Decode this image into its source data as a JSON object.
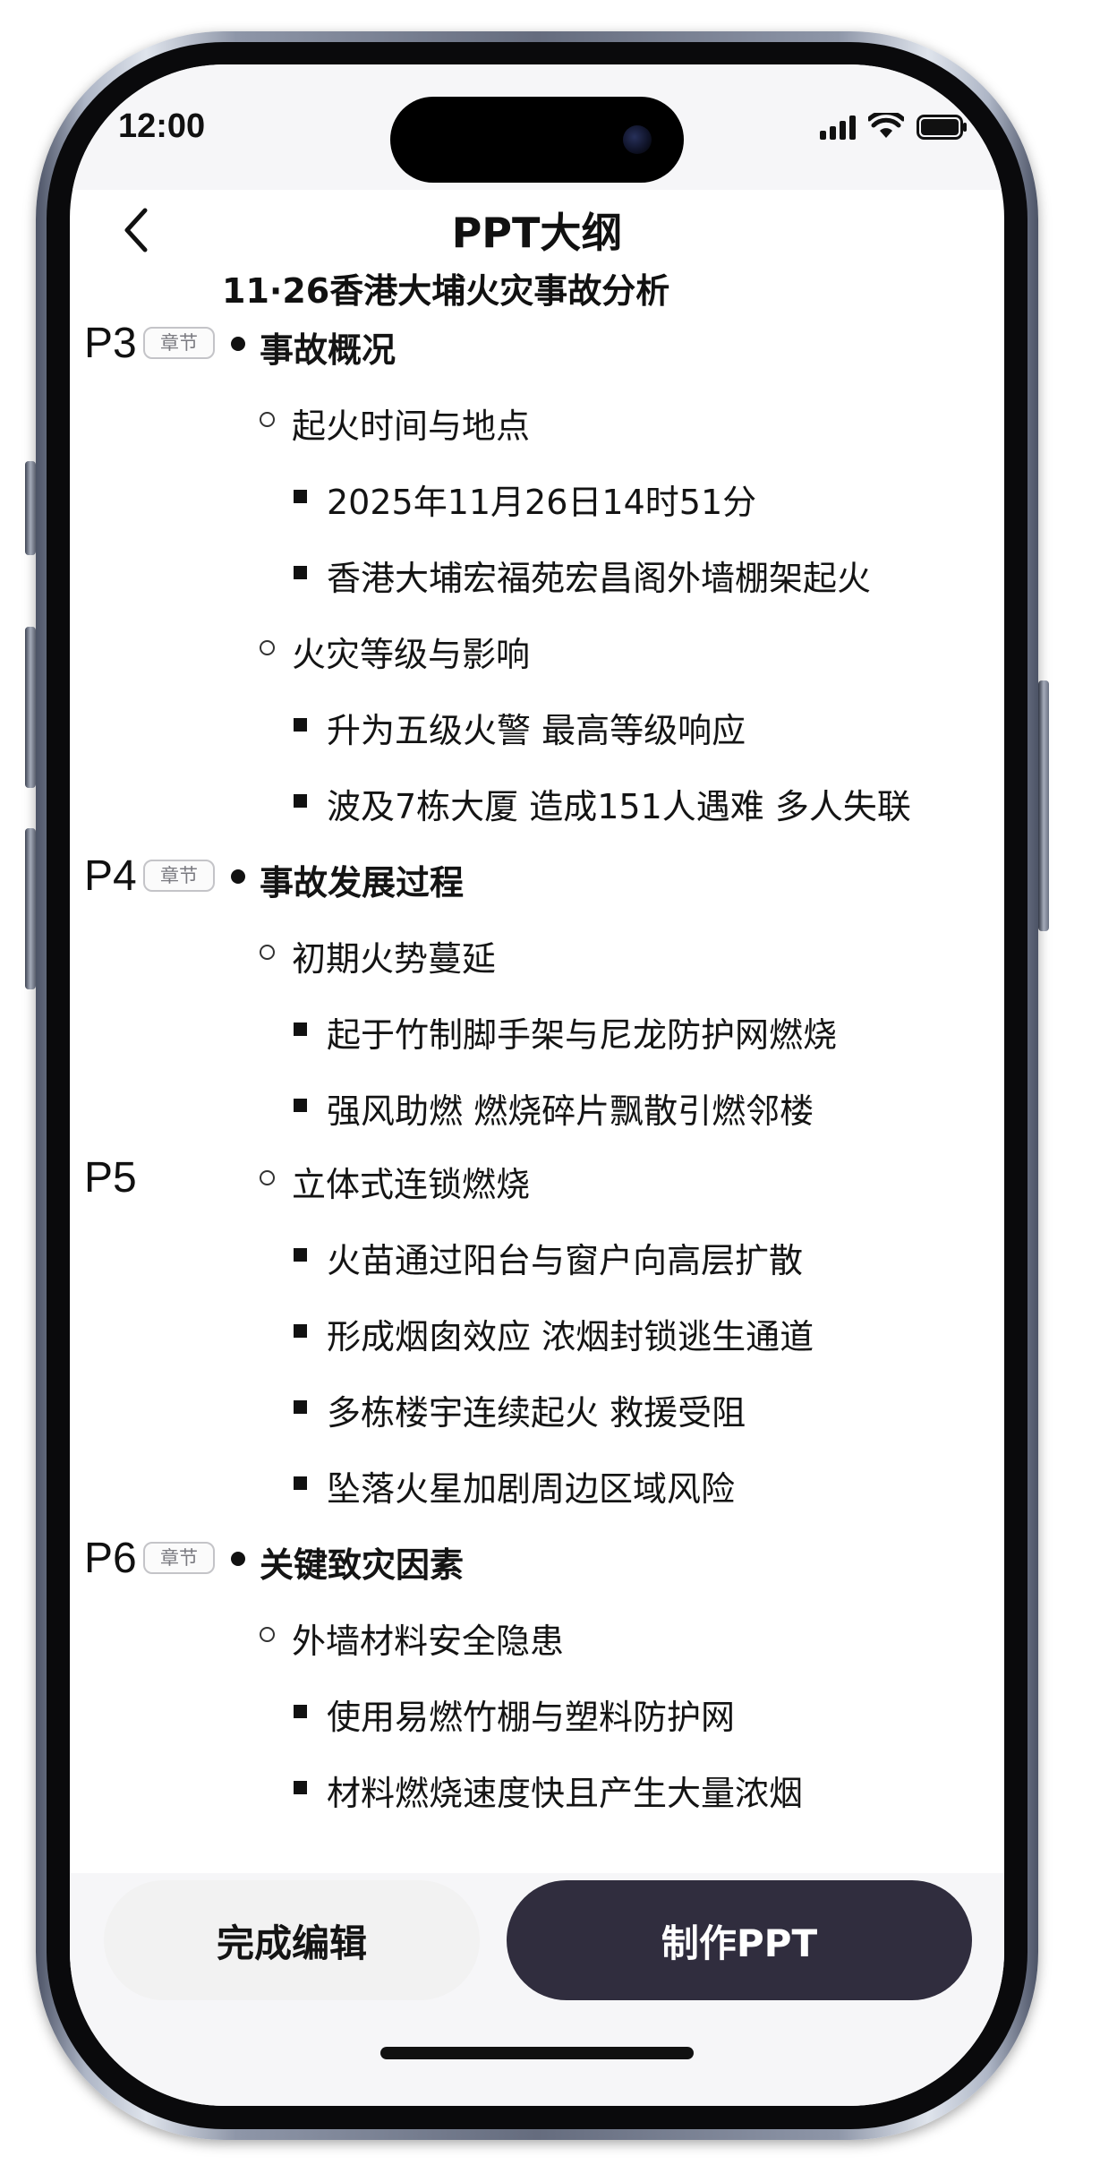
{
  "status_bar": {
    "time": "12:00",
    "icons": [
      "cellular-signal-icon",
      "wifi-icon",
      "battery-icon"
    ]
  },
  "header": {
    "back_icon": "chevron-left-icon",
    "title": "PPT大纲"
  },
  "outline": {
    "title": "11·26香港大埔火灾事故分析",
    "chapter_tag": "章节",
    "rows": [
      {
        "page": "P3",
        "chapter": true,
        "level": 1,
        "text": "事故概况"
      },
      {
        "level": 2,
        "text": "起火时间与地点"
      },
      {
        "level": 3,
        "text": "2025年11月26日14时51分"
      },
      {
        "level": 3,
        "text": "香港大埔宏福苑宏昌阁外墙棚架起火"
      },
      {
        "level": 2,
        "text": "火灾等级与影响"
      },
      {
        "level": 3,
        "text": "升为五级火警 最高等级响应"
      },
      {
        "level": 3,
        "text": "波及7栋大厦 造成151人遇难 多人失联"
      },
      {
        "page": "P4",
        "chapter": true,
        "level": 1,
        "text": "事故发展过程"
      },
      {
        "level": 2,
        "text": "初期火势蔓延"
      },
      {
        "level": 3,
        "text": "起于竹制脚手架与尼龙防护网燃烧"
      },
      {
        "level": 3,
        "text": "强风助燃 燃烧碎片飘散引燃邻楼"
      },
      {
        "page": "P5",
        "chapter": false,
        "level": 2,
        "text": "立体式连锁燃烧"
      },
      {
        "level": 3,
        "text": "火苗通过阳台与窗户向高层扩散"
      },
      {
        "level": 3,
        "text": "形成烟囱效应 浓烟封锁逃生通道"
      },
      {
        "level": 3,
        "text": "多栋楼宇连续起火 救援受阻"
      },
      {
        "level": 3,
        "text": "坠落火星加剧周边区域风险"
      },
      {
        "page": "P6",
        "chapter": true,
        "level": 1,
        "text": "关键致灾因素"
      },
      {
        "level": 2,
        "text": "外墙材料安全隐患"
      },
      {
        "level": 3,
        "text": "使用易燃竹棚与塑料防护网"
      },
      {
        "level": 3,
        "text": "材料燃烧速度快且产生大量浓烟"
      }
    ]
  },
  "actions": {
    "finish_label": "完成编辑",
    "make_ppt_label": "制作PPT"
  },
  "colors": {
    "primary_button": "#302d3e",
    "secondary_button": "#f2f2f2",
    "tag_border": "#c4c4c8"
  }
}
